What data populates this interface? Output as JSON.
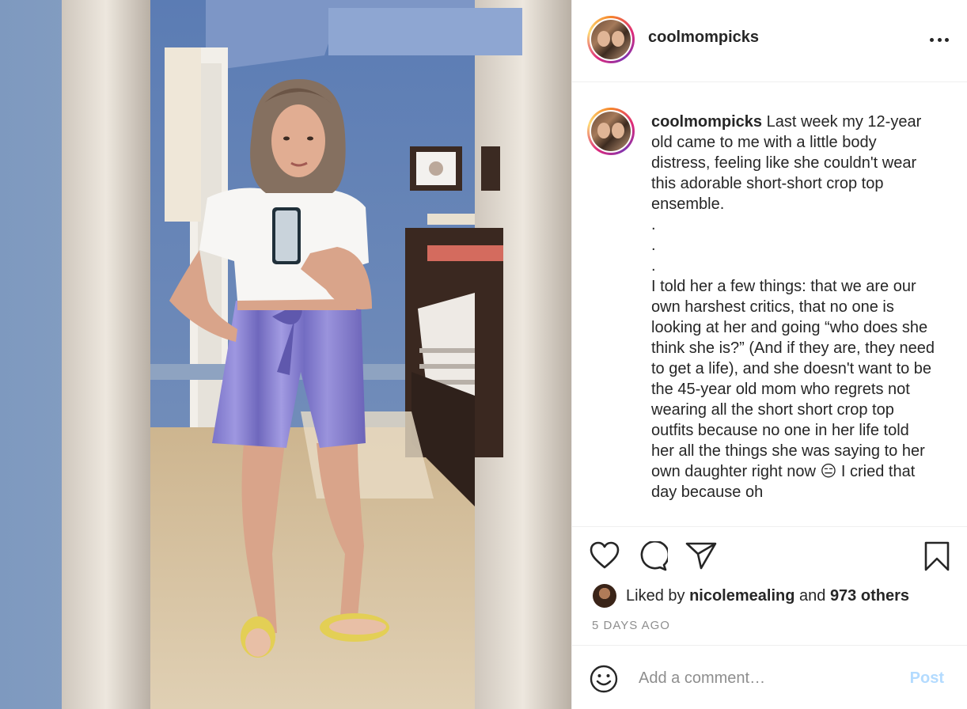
{
  "post": {
    "username": "coolmompicks",
    "photo_description": "Woman taking a mirror selfie in white crop top and purple striped shorts"
  },
  "caption": {
    "username": "coolmompicks",
    "text": "Last week my 12-year old came to me with a little body distress, feeling like she couldn't wear this adorable short-short crop top ensemble.\n.\n.\n.\nI told her a few things: that we are our own harshest critics, that no one is looking at her and going “who does she think she is?” (And if they are, they need to get a life), and she doesn't want to be the 45-year old mom who regrets not wearing all the short short crop top outfits because no one in her life told her all the things she was saying to her own daughter right now 😑 I cried that day because oh"
  },
  "likes": {
    "prefix": "Liked by",
    "user": "nicolemealing",
    "connector": "and",
    "others": "973 others"
  },
  "timestamp": "5 DAYS AGO",
  "comment_box": {
    "placeholder": "Add a comment…",
    "post_label": "Post"
  },
  "icons": {
    "more": "more-options-icon",
    "like": "heart-icon",
    "comment": "comment-icon",
    "share": "share-icon",
    "save": "bookmark-icon",
    "emoji": "emoji-icon"
  },
  "colors": {
    "text": "#262626",
    "muted": "#8e8e8e",
    "post_disabled": "#b3dbff",
    "border": "#efefef"
  }
}
